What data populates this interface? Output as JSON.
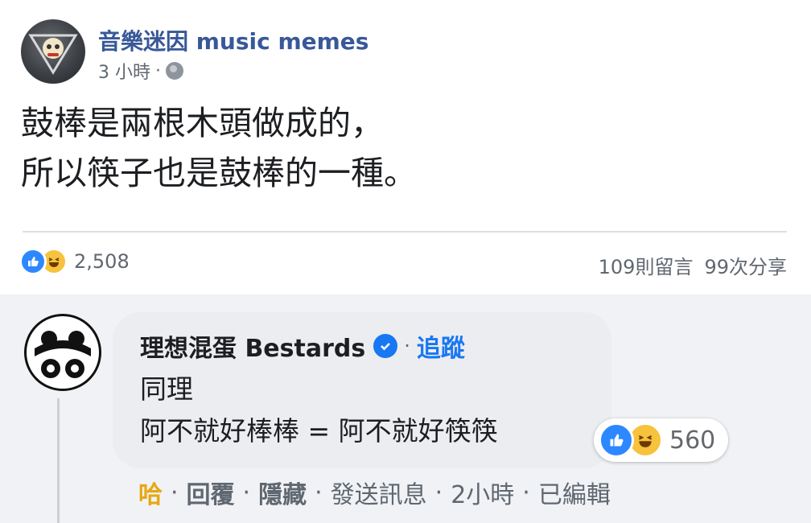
{
  "post": {
    "page_name": "音樂迷因 music memes",
    "time": "3 小時",
    "separator": "·",
    "text_line1": "鼓棒是兩根木頭做成的，",
    "text_line2": "所以筷子也是鼓棒的一種。",
    "reaction_count": "2,508",
    "comments": "109則留言",
    "shares": "99次分享"
  },
  "comment": {
    "author": "理想混蛋 Bestards",
    "separator": "·",
    "follow": "追蹤",
    "line1": "同理",
    "line2": "阿不就好棒棒 = 阿不就好筷筷",
    "reaction_count": "560",
    "actions": {
      "haha": "哈",
      "reply": "回覆",
      "hide": "隱藏",
      "message": "發送訊息",
      "time": "2小時",
      "edited": "已編輯",
      "sep": "·"
    }
  },
  "colors": {
    "link": "#385898",
    "accent": "#1877f2",
    "like": "#2d88ff",
    "haha": "#f7c23c",
    "muted": "#606770"
  },
  "icons": [
    "globe-icon",
    "like-icon",
    "haha-icon",
    "verified-icon"
  ]
}
